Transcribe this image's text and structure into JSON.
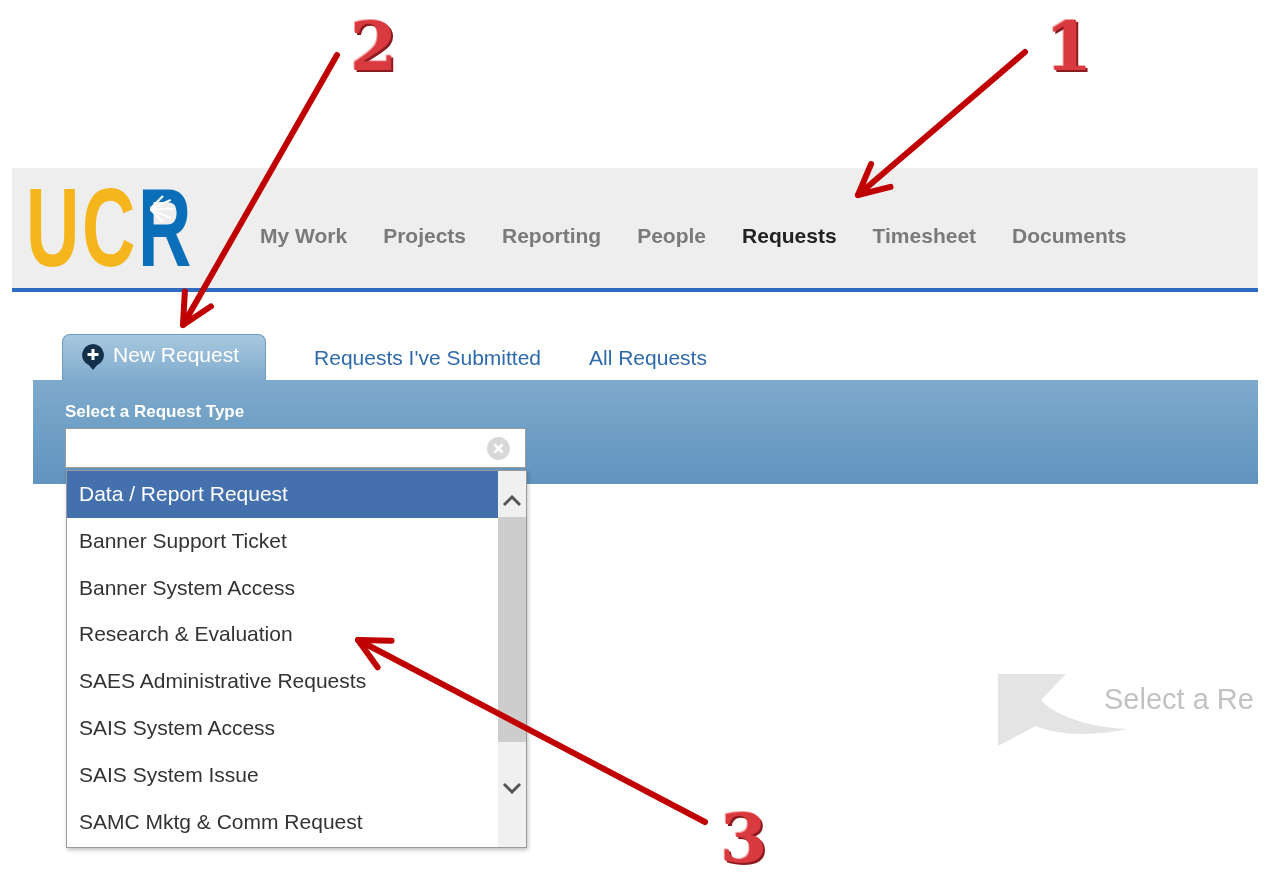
{
  "logo": {
    "text": "UCR"
  },
  "nav": [
    {
      "label": "My Work",
      "selected": false
    },
    {
      "label": "Projects",
      "selected": false
    },
    {
      "label": "Reporting",
      "selected": false
    },
    {
      "label": "People",
      "selected": false
    },
    {
      "label": "Requests",
      "selected": true
    },
    {
      "label": "Timesheet",
      "selected": false
    },
    {
      "label": "Documents",
      "selected": false
    }
  ],
  "tabs": [
    {
      "label": "New Request",
      "selected": true
    },
    {
      "label": "Requests I've Submitted",
      "selected": false
    },
    {
      "label": "All Requests",
      "selected": false
    }
  ],
  "request_type": {
    "label": "Select a Request Type",
    "options": [
      {
        "label": "Data / Report Request",
        "selected": true
      },
      {
        "label": "Banner Support Ticket",
        "selected": false
      },
      {
        "label": "Banner System Access",
        "selected": false
      },
      {
        "label": "Research & Evaluation",
        "selected": false
      },
      {
        "label": "SAES Administrative Requests",
        "selected": false
      },
      {
        "label": "SAIS System Access",
        "selected": false
      },
      {
        "label": "SAIS System Issue",
        "selected": false
      },
      {
        "label": "SAMC Mktg & Comm Request",
        "selected": false
      }
    ]
  },
  "empty_state": {
    "text": "Select a Re"
  },
  "annotations": [
    {
      "label": "2"
    },
    {
      "label": "1"
    },
    {
      "label": "3"
    }
  ]
}
